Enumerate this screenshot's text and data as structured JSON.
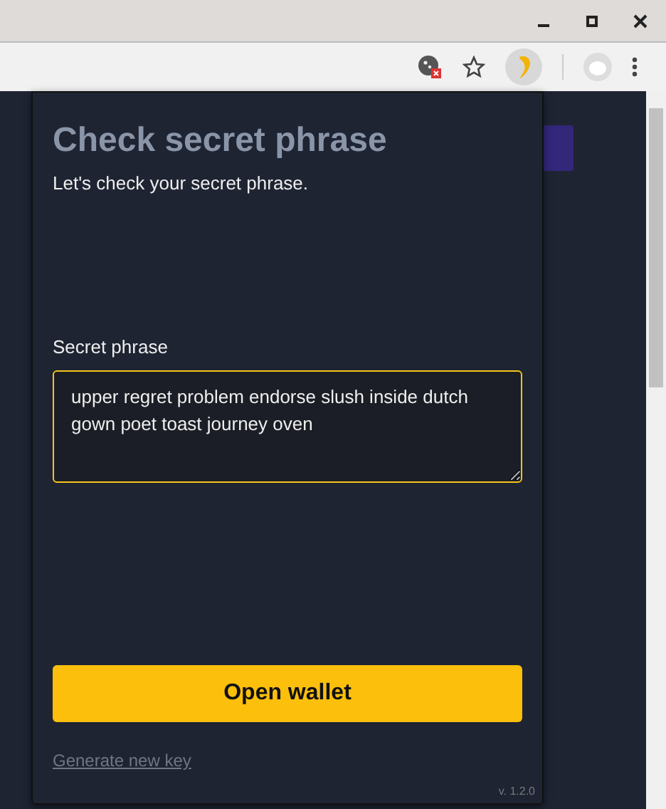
{
  "popup": {
    "title": "Check secret phrase",
    "subtitle": "Let's check your secret phrase.",
    "field_label": "Secret phrase",
    "phrase": "upper regret problem endorse slush inside dutch gown poet toast journey oven",
    "button": "Open wallet",
    "link": "Generate new key",
    "version": "v. 1.2.0"
  }
}
